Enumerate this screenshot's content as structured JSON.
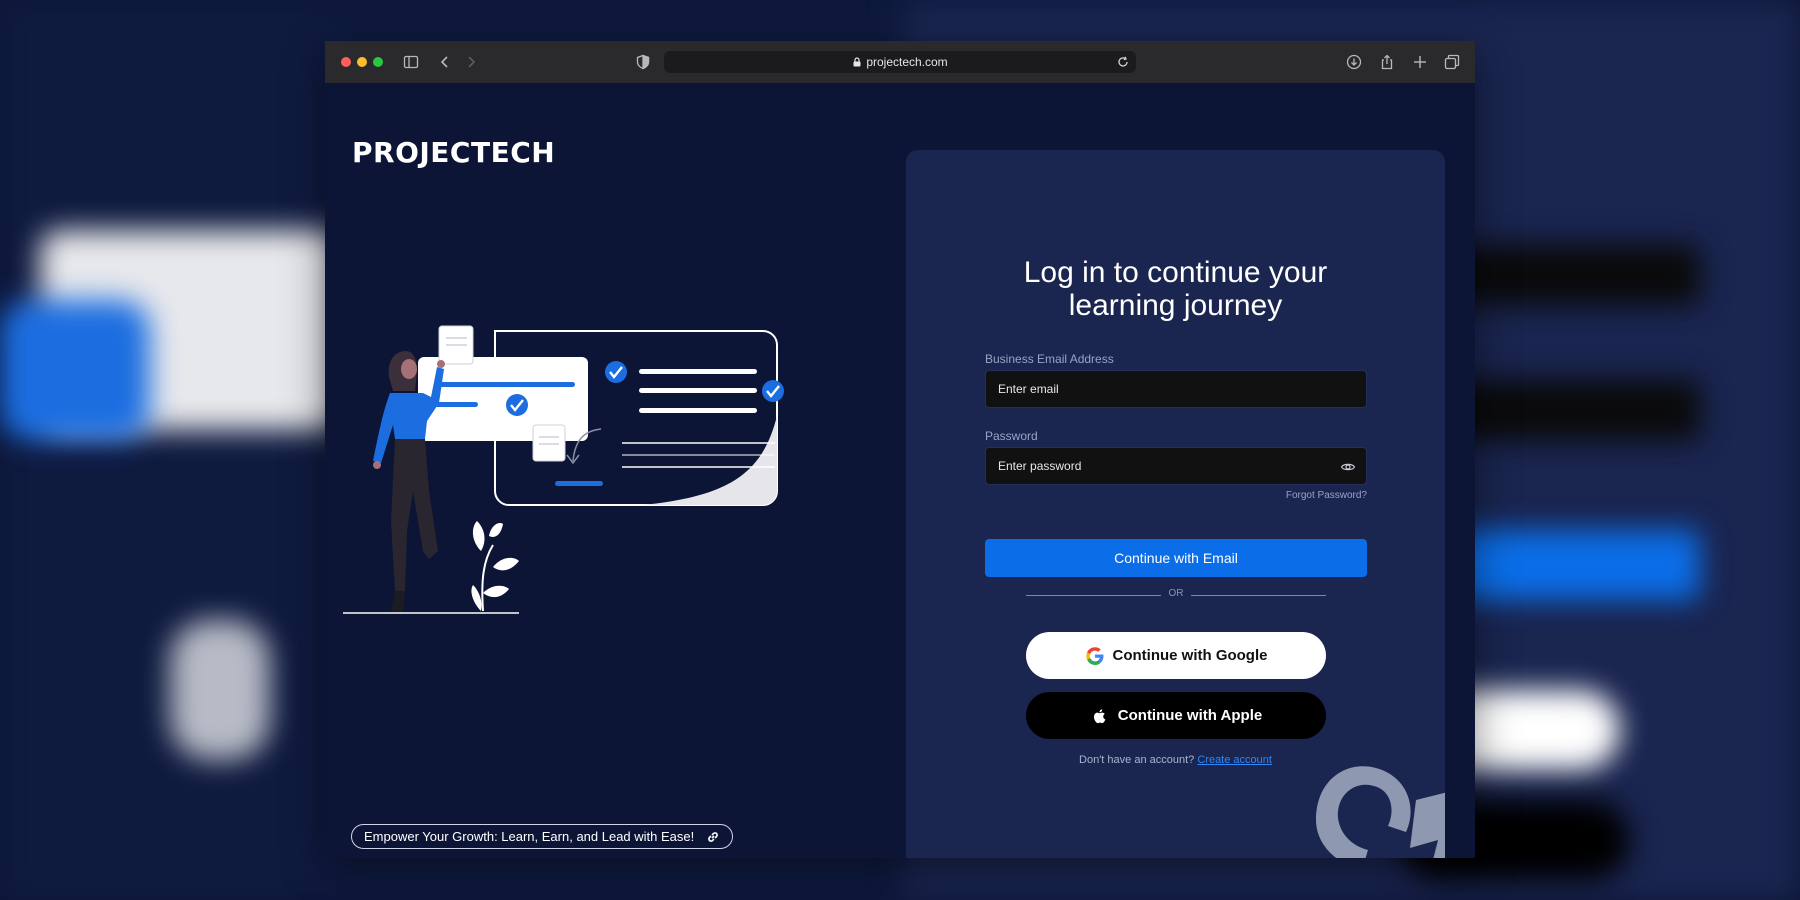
{
  "browser": {
    "url": "projectech.com"
  },
  "brand": {
    "logo_text": "PROJECTECH",
    "tagline": "Empower Your Growth: Learn, Earn, and Lead with Ease!"
  },
  "login": {
    "heading_line1": "Log in to continue your",
    "heading_line2": "learning journey",
    "email_label": "Business Email Address",
    "email_placeholder": "Enter email",
    "password_label": "Password",
    "password_placeholder": "Enter password",
    "forgot_password": "Forgot Password?",
    "continue_email": "Continue with Email",
    "or": "OR",
    "continue_google": "Continue with Google",
    "continue_apple": "Continue with Apple",
    "no_account": "Don't have an account?",
    "create_account": "Create account"
  },
  "colors": {
    "background": "#0c1535",
    "card": "#1b2650",
    "accent": "#0b6ee8",
    "link": "#2f86f6"
  },
  "icons": [
    "sidebar-icon",
    "back-icon",
    "forward-icon",
    "shield-icon",
    "lock-icon",
    "reload-icon",
    "download-icon",
    "share-icon",
    "new-tab-icon",
    "tabs-icon",
    "eye-icon",
    "google-icon",
    "apple-icon",
    "link-icon"
  ]
}
